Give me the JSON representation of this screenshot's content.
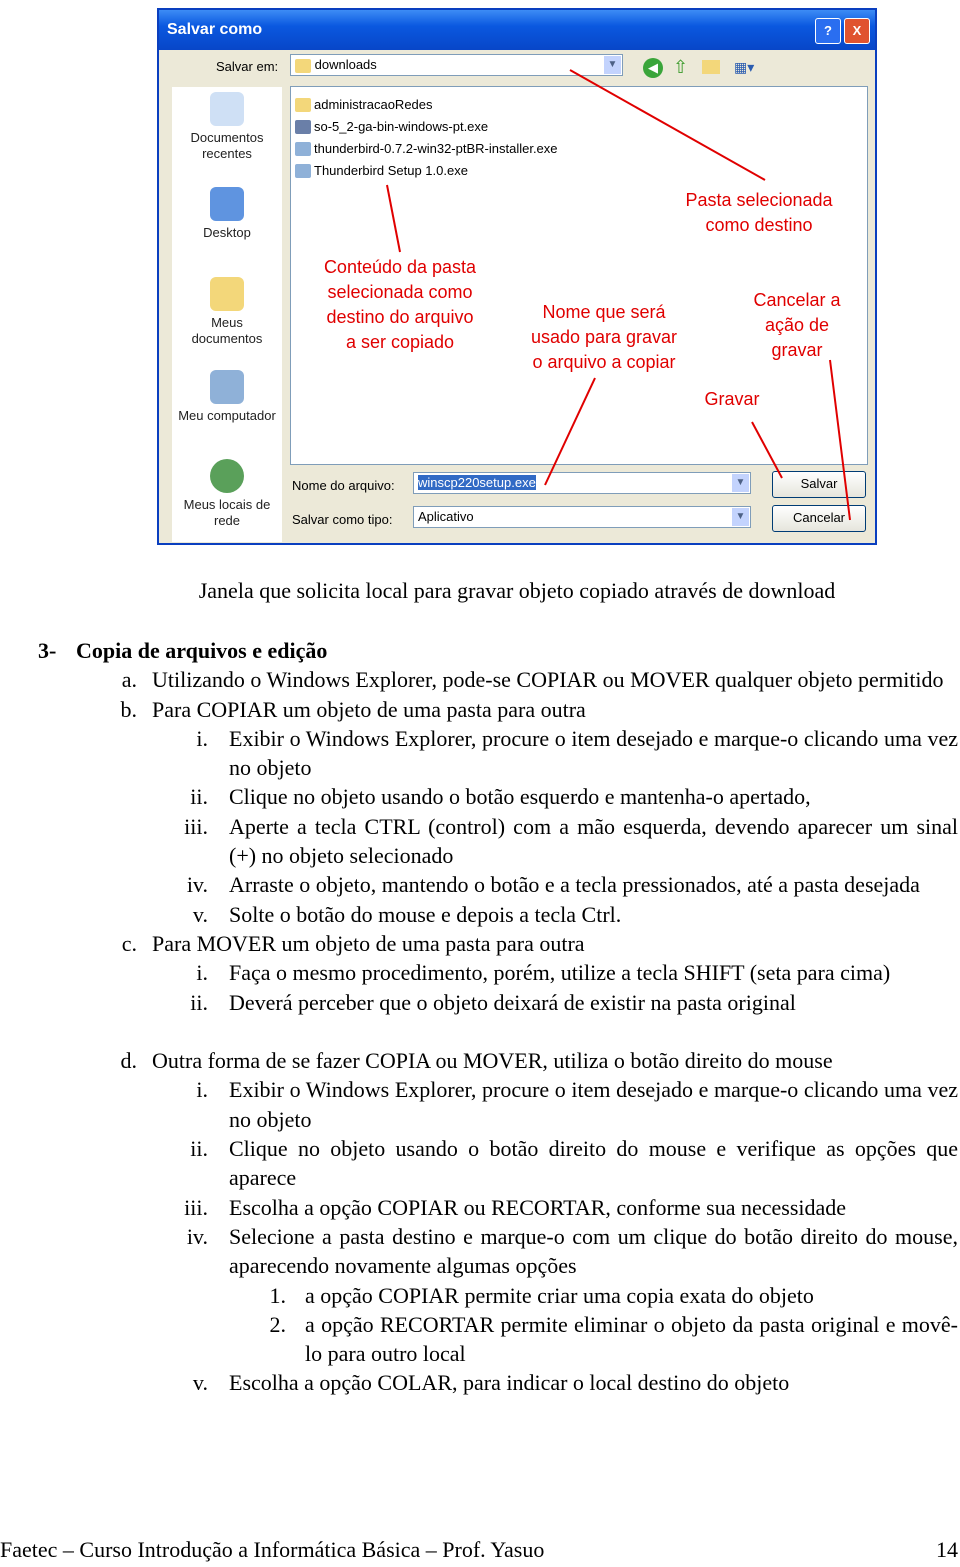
{
  "dialog": {
    "title": "Salvar como",
    "help": "?",
    "close": "X",
    "save_in_label": "Salvar em:",
    "save_in_value": "downloads",
    "places": [
      "Documentos recentes",
      "Desktop",
      "Meus documentos",
      "Meu computador",
      "Meus locais de rede"
    ],
    "files": [
      {
        "name": "administracaoRedes",
        "icon": "folder"
      },
      {
        "name": "so-5_2-ga-bin-windows-pt.exe",
        "icon": "installer"
      },
      {
        "name": "thunderbird-0.7.2-win32-ptBR-installer.exe",
        "icon": "thunderbird"
      },
      {
        "name": "Thunderbird Setup 1.0.exe",
        "icon": "thunderbird"
      }
    ],
    "filename_label": "Nome do arquivo:",
    "filename_value": "winscp220setup.exe",
    "type_label": "Salvar como tipo:",
    "type_value": "Aplicativo",
    "save_button": "Salvar",
    "cancel_button": "Cancelar"
  },
  "annotations": {
    "destination": "Pasta selecionada\ncomo destino",
    "contents": "Conteúdo da pasta\nselecionada como\ndestino do arquivo\na ser copiado",
    "filename": "Nome que será\nusado para gravar\no arquivo a copiar",
    "cancel": "Cancelar a\nação de\ngravar",
    "save": "Gravar",
    "color": "#e00000"
  },
  "caption": "Janela que solicita local para gravar objeto copiado através de download",
  "section": {
    "number": "3-",
    "title": "Copia de arquivos e edição",
    "items": [
      {
        "m": "a.",
        "t": "Utilizando o Windows Explorer, pode-se COPIAR ou MOVER qualquer objeto permitido"
      },
      {
        "m": "b.",
        "t": "Para COPIAR um objeto de uma pasta para outra",
        "sub": [
          {
            "m": "i.",
            "t": "Exibir o Windows Explorer, procure o item desejado e marque-o clicando uma vez no objeto"
          },
          {
            "m": "ii.",
            "t": "Clique no objeto usando o botão esquerdo e mantenha-o apertado,"
          },
          {
            "m": "iii.",
            "t": "Aperte a tecla CTRL (control) com a mão esquerda, devendo aparecer um sinal (+) no objeto selecionado"
          },
          {
            "m": "iv.",
            "t": "Arraste o objeto, mantendo o botão e a tecla pressionados, até a pasta desejada"
          },
          {
            "m": "v.",
            "t": "Solte o botão do mouse e depois a tecla Ctrl."
          }
        ]
      },
      {
        "m": "c.",
        "t": "Para MOVER um objeto de uma pasta para outra",
        "sub": [
          {
            "m": "i.",
            "t": "Faça o mesmo procedimento, porém, utilize a tecla SHIFT (seta para cima)"
          },
          {
            "m": "ii.",
            "t": "Deverá perceber que o objeto deixará de existir na pasta original"
          }
        ]
      },
      {
        "m": "d.",
        "t": "Outra forma de se fazer COPIA ou MOVER, utiliza o botão direito do mouse",
        "gap": true,
        "sub": [
          {
            "m": "i.",
            "t": "Exibir o Windows Explorer, procure o item desejado e marque-o clicando uma vez no objeto"
          },
          {
            "m": "ii.",
            "t": "Clique no objeto usando o botão direito do mouse e verifique as opções que aparece"
          },
          {
            "m": "iii.",
            "t": "Escolha a opção COPIAR ou RECORTAR, conforme sua necessidade"
          },
          {
            "m": "iv.",
            "t": "Selecione a pasta destino e marque-o com um clique do botão direito do mouse, aparecendo novamente algumas opções",
            "sub": [
              {
                "m": "1.",
                "t": "a opção COPIAR permite criar uma copia exata do objeto"
              },
              {
                "m": "2.",
                "t": "a opção RECORTAR permite eliminar o objeto da pasta original e movê-lo para outro local"
              }
            ]
          },
          {
            "m": "v.",
            "t": "Escolha a opção COLAR, para indicar o local destino do objeto"
          }
        ]
      }
    ]
  },
  "footer": {
    "text": "Faetec – Curso Introdução a Informática Básica – Prof. Yasuo",
    "page": "14"
  }
}
